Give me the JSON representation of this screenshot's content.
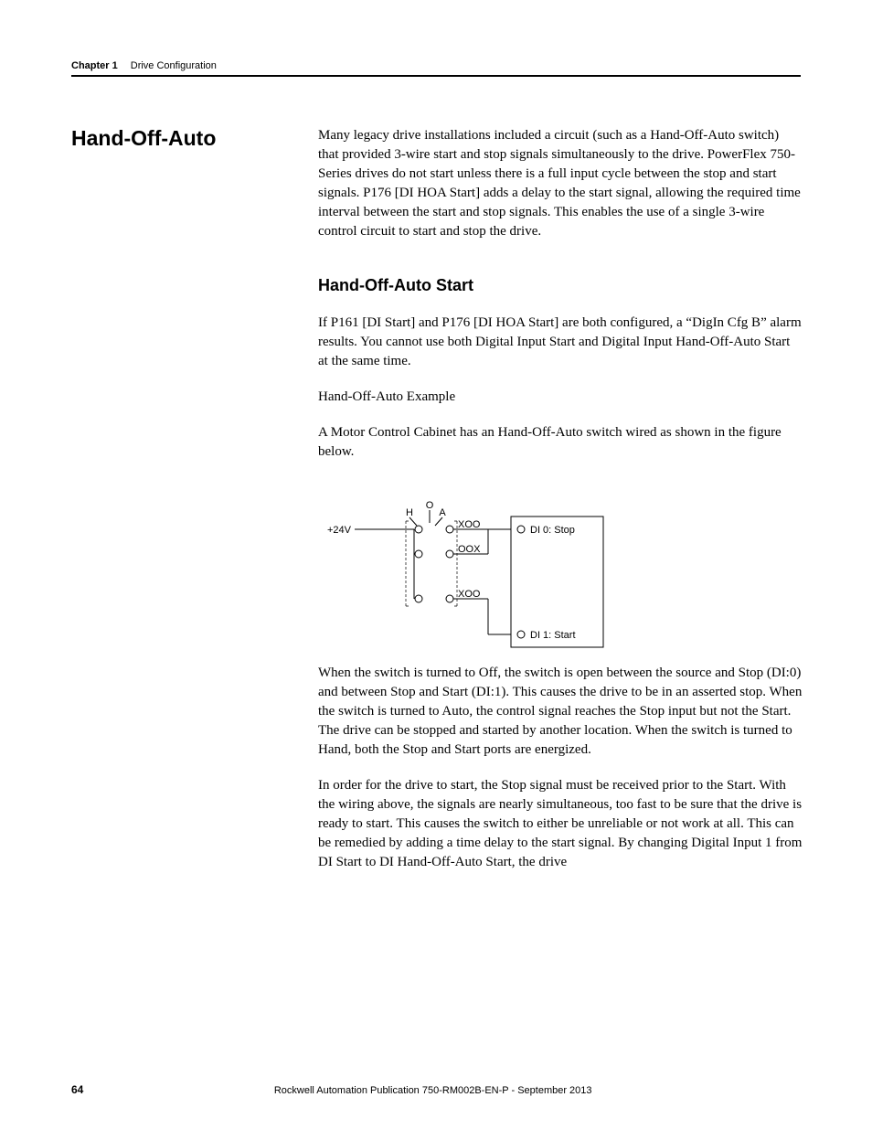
{
  "header": {
    "chapter_label": "Chapter 1",
    "chapter_title": "Drive Configuration"
  },
  "section_title": "Hand-Off-Auto",
  "intro_para": "Many legacy drive installations included a circuit (such as a Hand-Off-Auto switch) that provided 3-wire start and stop signals simultaneously to the drive. PowerFlex 750-Series drives do not start unless there is a full input cycle between the stop and start signals. P176 [DI HOA Start] adds a delay to the start signal, allowing the required time interval between the start and stop signals. This enables the use of a single 3-wire control circuit to start and stop the drive.",
  "subheading": "Hand-Off-Auto Start",
  "para_alarm": "If P161 [DI Start] and P176 [DI HOA Start] are both configured, a “DigIn Cfg B” alarm results. You cannot use both Digital Input Start and Digital Input Hand-Off-Auto Start at the same time.",
  "para_example_label": "Hand-Off-Auto Example",
  "para_cabinet": "A Motor Control Cabinet has an Hand-Off-Auto switch wired as shown in the figure below.",
  "diagram": {
    "label_24v": "+24V",
    "label_H": "H",
    "label_O": "O",
    "label_A": "A",
    "xoo1": "XOO",
    "oox": "OOX",
    "xoo2": "XOO",
    "di0": "DI 0: Stop",
    "di1": "DI 1: Start"
  },
  "para_switch_off": "When the switch is turned to Off, the switch is open between the source and Stop (DI:0) and between Stop and Start (DI:1). This causes the drive to be in an asserted stop. When the switch is turned to Auto, the control signal reaches the Stop input but not the Start. The drive can be stopped and started by another location. When the switch is turned to Hand, both the Stop and Start ports are energized.",
  "para_start_timing": "In order for the drive to start, the Stop signal must be received prior to the Start. With the wiring above, the signals are nearly simultaneous, too fast to be sure that the drive is ready to start. This causes the switch to either be unreliable or not work at all. This can be remedied by adding a time delay to the start signal. By changing Digital Input 1 from DI Start to DI Hand-Off-Auto Start, the drive",
  "footer": {
    "page": "64",
    "publication": "Rockwell Automation Publication 750-RM002B-EN-P - September 2013"
  }
}
